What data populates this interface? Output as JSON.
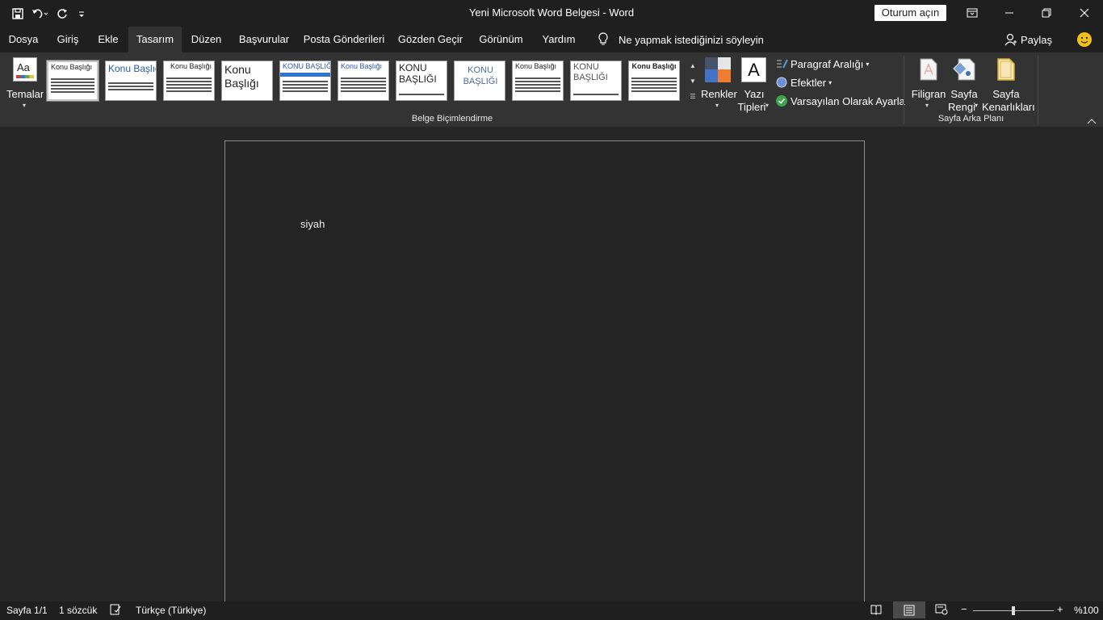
{
  "titlebar": {
    "title": "Yeni Microsoft Word Belgesi  -  Word",
    "signin": "Oturum açın",
    "qat": [
      "save-icon",
      "undo-icon",
      "redo-icon",
      "customize-icon"
    ]
  },
  "tabs": [
    "Dosya",
    "Giriş",
    "Ekle",
    "Tasarım",
    "Düzen",
    "Başvurular",
    "Posta Gönderileri",
    "Gözden Geçir",
    "Görünüm",
    "Yardım"
  ],
  "active_tab": "Tasarım",
  "tellme": "Ne yapmak istediğinizi söyleyin",
  "share": "Paylaş",
  "ribbon": {
    "themes": "Temalar",
    "gallery_titles": [
      "Konu Başlığı",
      "Konu Başlığı",
      "Konu Başlığı",
      "Konu Başlığı",
      "KONU BAŞLIĞI",
      "Konu Başlığı",
      "KONU BAŞLIĞI",
      "KONU BAŞLIĞI",
      "Konu Başlığı",
      "KONU BAŞLIĞI",
      "Konu Başlığı"
    ],
    "colors": "Renkler",
    "fonts_line1": "Yazı",
    "fonts_line2": "Tipleri",
    "fonts_glyph": "A",
    "paragraph_spacing": "Paragraf Aralığı",
    "effects": "Efektler",
    "set_default": "Varsayılan Olarak Ayarla",
    "watermark": "Filigran",
    "page_color_line1": "Sayfa",
    "page_color_line2": "Rengi",
    "page_borders_line1": "Sayfa",
    "page_borders_line2": "Kenarlıkları",
    "group_document_formatting": "Belge Biçimlendirme",
    "group_page_background": "Sayfa Arka Planı"
  },
  "document": {
    "text": "siyah"
  },
  "status": {
    "page": "Sayfa 1/1",
    "words": "1 sözcük",
    "language": "Türkçe (Türkiye)",
    "zoom": "%100",
    "zoom_minus": "−",
    "zoom_plus": "+"
  }
}
